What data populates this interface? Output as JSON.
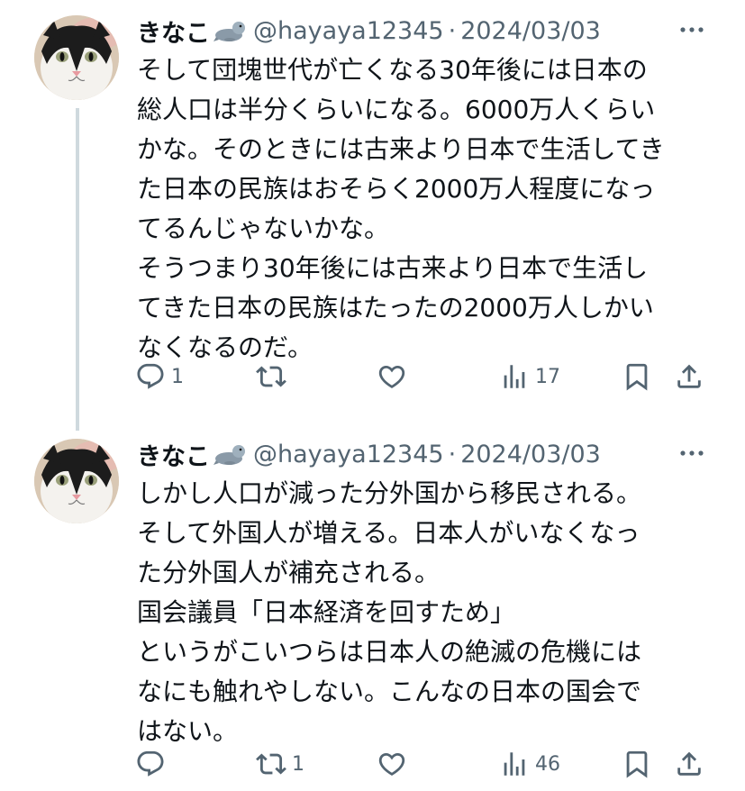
{
  "colors": {
    "text": "#0f1419",
    "secondary": "#536471",
    "thread_line": "#cfd9de"
  },
  "tweets": [
    {
      "display_name": "きなこ",
      "name_emoji": "seal-emoji",
      "handle": "@hayaya12345",
      "separator": "·",
      "date": "2024/03/03",
      "body": "そして団塊世代が亡くなる30年後には日本の\n総人口は半分くらいになる。6000万人くらい\nかな。そのときには古来より日本で生活してき\nた日本の民族はおそらく2000万人程度になっ\nてるんじゃないかな。\nそうつまり30年後には古来より日本で生活し\nてきた日本の民族はたったの2000万人しかい\nなくなるのだ。",
      "replies": "1",
      "retweets": "",
      "likes": "",
      "views": "17"
    },
    {
      "display_name": "きなこ",
      "name_emoji": "seal-emoji",
      "handle": "@hayaya12345",
      "separator": "·",
      "date": "2024/03/03",
      "body": "しかし人口が減った分外国から移民される。\nそして外国人が増える。日本人がいなくなっ\nた分外国人が補充される。\n国会議員「日本経済を回すため」\nというがこいつらは日本人の絶滅の危機には\nなにも触れやしない。こんなの日本の国会で\nはない。",
      "replies": "",
      "retweets": "1",
      "likes": "",
      "views": "46"
    }
  ]
}
